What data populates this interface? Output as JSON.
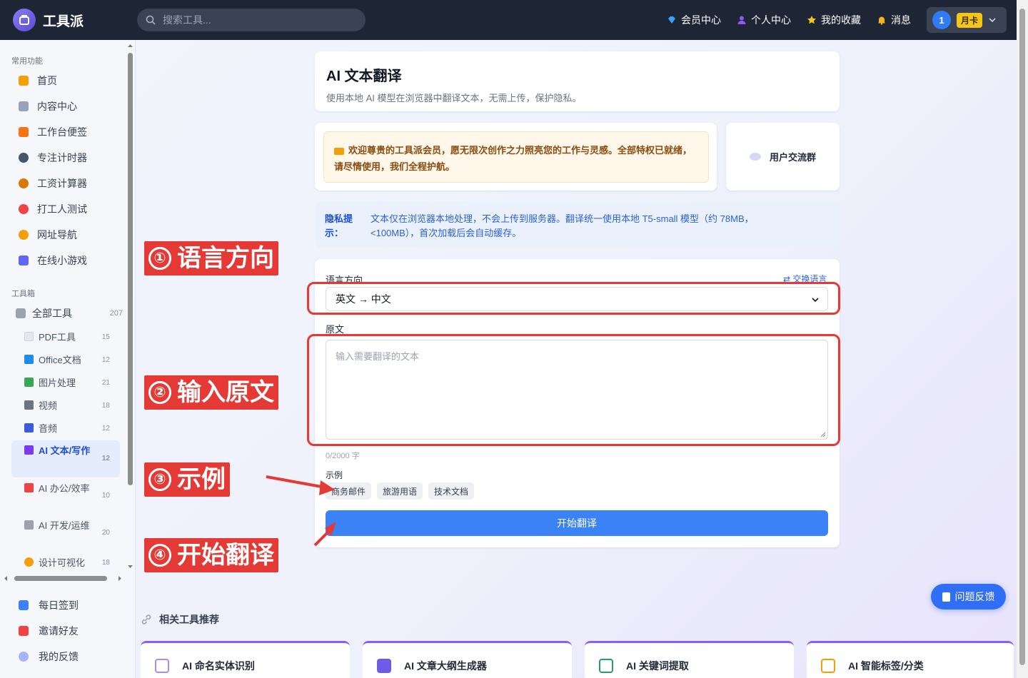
{
  "app": {
    "title": "工具派"
  },
  "search": {
    "placeholder": "搜索工具..."
  },
  "topnav": {
    "items": [
      {
        "label": "会员中心",
        "icon": "diamond-icon",
        "color": "#3aa0ff"
      },
      {
        "label": "个人中心",
        "icon": "user-icon",
        "color": "#8b5cf6"
      },
      {
        "label": "我的收藏",
        "icon": "star-icon",
        "color": "#f5c518"
      },
      {
        "label": "消息",
        "icon": "bell-icon",
        "color": "#f5b518"
      }
    ],
    "user": {
      "avatar_text": "1",
      "badge": "月卡"
    }
  },
  "sidebar": {
    "section_common": "常用功能",
    "common": [
      {
        "label": "首页",
        "icon": "home-icon",
        "color": "#f59e0b"
      },
      {
        "label": "内容中心",
        "icon": "news-icon",
        "color": "#94a3b8"
      },
      {
        "label": "工作台便签",
        "icon": "memo-icon",
        "color": "#f97316"
      },
      {
        "label": "专注计时器",
        "icon": "timer-icon",
        "color": "#475569"
      },
      {
        "label": "工资计算器",
        "icon": "money-bag-icon",
        "color": "#d97706"
      },
      {
        "label": "打工人测试",
        "icon": "target-icon",
        "color": "#ef4444"
      },
      {
        "label": "网址导航",
        "icon": "compass-icon",
        "color": "#f59e0b"
      },
      {
        "label": "在线小游戏",
        "icon": "gamepad-icon",
        "color": "#6366f1"
      }
    ],
    "section_tools": "工具箱",
    "all_tools": {
      "label": "全部工具",
      "count": "207",
      "icon": "tools-icon"
    },
    "tools": [
      {
        "label": "PDF工具",
        "count": "15",
        "icon": "pdf-icon",
        "color": "#e5e7eb"
      },
      {
        "label": "Office文档",
        "count": "12",
        "icon": "office-icon",
        "color": "#1f8ceb"
      },
      {
        "label": "图片处理",
        "count": "21",
        "icon": "image-icon",
        "color": "#34a853"
      },
      {
        "label": "视频",
        "count": "18",
        "icon": "video-icon",
        "color": "#6b7280"
      },
      {
        "label": "音频",
        "count": "12",
        "icon": "music-icon",
        "color": "#3b5bdb"
      },
      {
        "label": "AI 文本/写作",
        "count": "12",
        "icon": "robot-icon",
        "color": "#7c3aed"
      },
      {
        "label": "AI 办公/效率",
        "count": "10",
        "icon": "rocket-icon",
        "color": "#ef4444"
      },
      {
        "label": "AI 开发/运维",
        "count": "20",
        "icon": "wrench-icon",
        "color": "#9ca3af"
      },
      {
        "label": "设计可视化",
        "count": "18",
        "icon": "palette-icon",
        "color": "#f59e0b"
      }
    ],
    "bottom": [
      {
        "label": "每日签到",
        "icon": "calendar-icon",
        "color": "#3b82f6"
      },
      {
        "label": "邀请好友",
        "icon": "gift-icon",
        "color": "#ef4444"
      },
      {
        "label": "我的反馈",
        "icon": "speech-bubble-icon",
        "color": "#a5b4fc"
      }
    ]
  },
  "page": {
    "title": "AI 文本翻译",
    "subtitle": "使用本地 AI 模型在浏览器中翻译文本，无需上传，保护隐私。"
  },
  "welcome": {
    "text": "欢迎尊贵的工具派会员，愿无限次创作之力照亮您的工作与灵感。全部特权已就绪，请尽情使用，我们全程护航。",
    "icon": "crown-icon"
  },
  "community": {
    "label": "用户交流群",
    "icon": "chat-bubble-icon"
  },
  "tip": {
    "title": "隐私提示：",
    "text": "文本仅在浏览器本地处理，不会上传到服务器。翻译统一使用本地 T5-small 模型（约 78MB，<100MB），首次加载后会自动缓存。"
  },
  "form": {
    "language_label": "语言方向",
    "swap_label": "⇄ 交换语言",
    "language_value": "英文 → 中文",
    "source_label": "原文",
    "source_placeholder": "输入需要翻译的文本",
    "char_count": "0/2000 字",
    "examples_label": "示例",
    "examples": [
      "商务邮件",
      "旅游用语",
      "技术文档"
    ],
    "start_label": "开始翻译"
  },
  "annotations": [
    {
      "num": "①",
      "text": "语言方向"
    },
    {
      "num": "②",
      "text": "输入原文"
    },
    {
      "num": "③",
      "text": "示例"
    },
    {
      "num": "④",
      "text": "开始翻译"
    }
  ],
  "feedback": {
    "label": "问题反馈",
    "icon": "document-icon"
  },
  "related": {
    "title": "相关工具推荐",
    "items": [
      {
        "label": "AI 命名实体识别",
        "icon": "id-card-icon",
        "color": "#a78bfa"
      },
      {
        "label": "AI 文章大纲生成器",
        "icon": "outline-icon",
        "color": "#6d5ce8"
      },
      {
        "label": "AI 关键词提取",
        "icon": "keyword-icon",
        "color": "#22a06b"
      },
      {
        "label": "AI 智能标签/分类",
        "icon": "box-icon",
        "color": "#f59e0b"
      }
    ]
  }
}
